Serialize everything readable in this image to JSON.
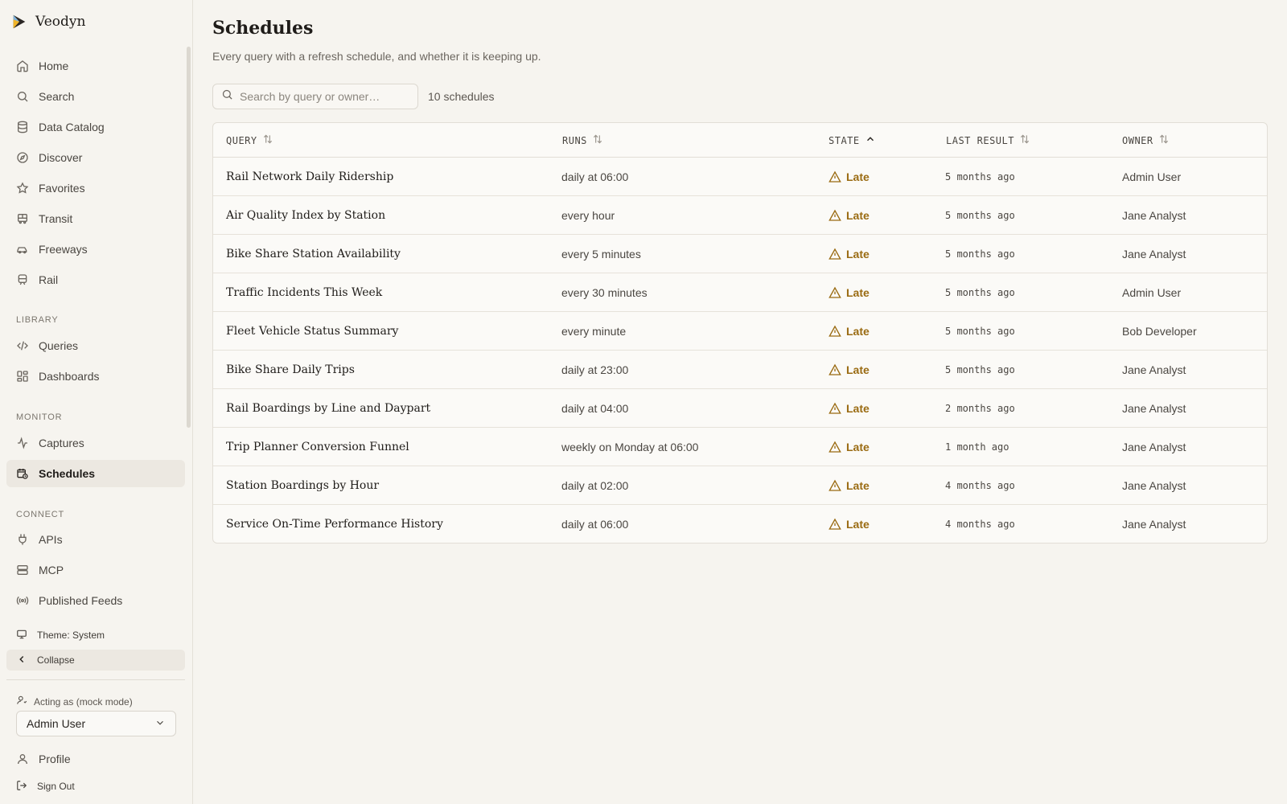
{
  "app": {
    "name": "Veodyn",
    "accent_color": "#f0b429"
  },
  "sidebar": {
    "nav": [
      {
        "label": "Home",
        "icon": "home-icon"
      },
      {
        "label": "Search",
        "icon": "search-icon"
      },
      {
        "label": "Data Catalog",
        "icon": "database-icon"
      },
      {
        "label": "Discover",
        "icon": "compass-icon"
      },
      {
        "label": "Favorites",
        "icon": "star-icon"
      },
      {
        "label": "Transit",
        "icon": "bus-icon"
      },
      {
        "label": "Freeways",
        "icon": "car-icon"
      },
      {
        "label": "Rail",
        "icon": "train-icon"
      }
    ],
    "library_label": "LIBRARY",
    "library": [
      {
        "label": "Queries",
        "icon": "code-icon"
      },
      {
        "label": "Dashboards",
        "icon": "dashboard-icon"
      }
    ],
    "monitor_label": "MONITOR",
    "monitor": [
      {
        "label": "Captures",
        "icon": "activity-icon"
      },
      {
        "label": "Schedules",
        "icon": "calendar-clock-icon",
        "active": true
      }
    ],
    "connect_label": "CONNECT",
    "connect": [
      {
        "label": "APIs",
        "icon": "plug-icon"
      },
      {
        "label": "MCP",
        "icon": "server-icon"
      },
      {
        "label": "Published Feeds",
        "icon": "radio-icon"
      }
    ],
    "theme_label": "Theme: System",
    "collapse_label": "Collapse",
    "acting_label": "Acting as (mock mode)",
    "acting_value": "Admin User",
    "profile_label": "Profile",
    "signout_label": "Sign Out"
  },
  "main": {
    "title": "Schedules",
    "subtitle": "Every query with a refresh schedule, and whether it is keeping up.",
    "search_placeholder": "Search by query or owner…",
    "count": "10 schedules",
    "columns": {
      "query": "QUERY",
      "runs": "RUNS",
      "state": "STATE",
      "last_result": "LAST RESULT",
      "owner": "OWNER"
    },
    "state_color": "#9a6b12",
    "rows": [
      {
        "query": "Rail Network Daily Ridership",
        "runs": "daily at 06:00",
        "state": "Late",
        "last": "5 months ago",
        "owner": "Admin User"
      },
      {
        "query": "Air Quality Index by Station",
        "runs": "every hour",
        "state": "Late",
        "last": "5 months ago",
        "owner": "Jane Analyst"
      },
      {
        "query": "Bike Share Station Availability",
        "runs": "every 5 minutes",
        "state": "Late",
        "last": "5 months ago",
        "owner": "Jane Analyst"
      },
      {
        "query": "Traffic Incidents This Week",
        "runs": "every 30 minutes",
        "state": "Late",
        "last": "5 months ago",
        "owner": "Admin User"
      },
      {
        "query": "Fleet Vehicle Status Summary",
        "runs": "every minute",
        "state": "Late",
        "last": "5 months ago",
        "owner": "Bob Developer"
      },
      {
        "query": "Bike Share Daily Trips",
        "runs": "daily at 23:00",
        "state": "Late",
        "last": "5 months ago",
        "owner": "Jane Analyst"
      },
      {
        "query": "Rail Boardings by Line and Daypart",
        "runs": "daily at 04:00",
        "state": "Late",
        "last": "2 months ago",
        "owner": "Jane Analyst"
      },
      {
        "query": "Trip Planner Conversion Funnel",
        "runs": "weekly on Monday at 06:00",
        "state": "Late",
        "last": "1 month ago",
        "owner": "Jane Analyst"
      },
      {
        "query": "Station Boardings by Hour",
        "runs": "daily at 02:00",
        "state": "Late",
        "last": "4 months ago",
        "owner": "Jane Analyst"
      },
      {
        "query": "Service On-Time Performance History",
        "runs": "daily at 06:00",
        "state": "Late",
        "last": "4 months ago",
        "owner": "Jane Analyst"
      }
    ]
  }
}
